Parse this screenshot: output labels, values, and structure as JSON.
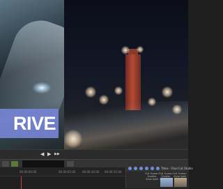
{
  "viewer": {
    "title_text": "RIVE"
  },
  "transport": {
    "prev_symbol": "◀",
    "play_symbol": "▶",
    "next_symbol": "▶▶"
  },
  "timeline": {
    "ruler_labels": [
      "00:00:00:00",
      "00:00:05:00",
      "00:00:10:00",
      "00:00:15:00"
    ]
  },
  "browser": {
    "title": "Titles · Final Cut Studio",
    "items": [
      {
        "label": "Full Screen Smaller Zone Split"
      },
      {
        "label": "Full Screen Smaller Zone Split"
      },
      {
        "label": "Full Screen Zone Split"
      }
    ]
  },
  "colors": {
    "title_banner": "#7684d4",
    "timecode": "#7fe07f"
  }
}
